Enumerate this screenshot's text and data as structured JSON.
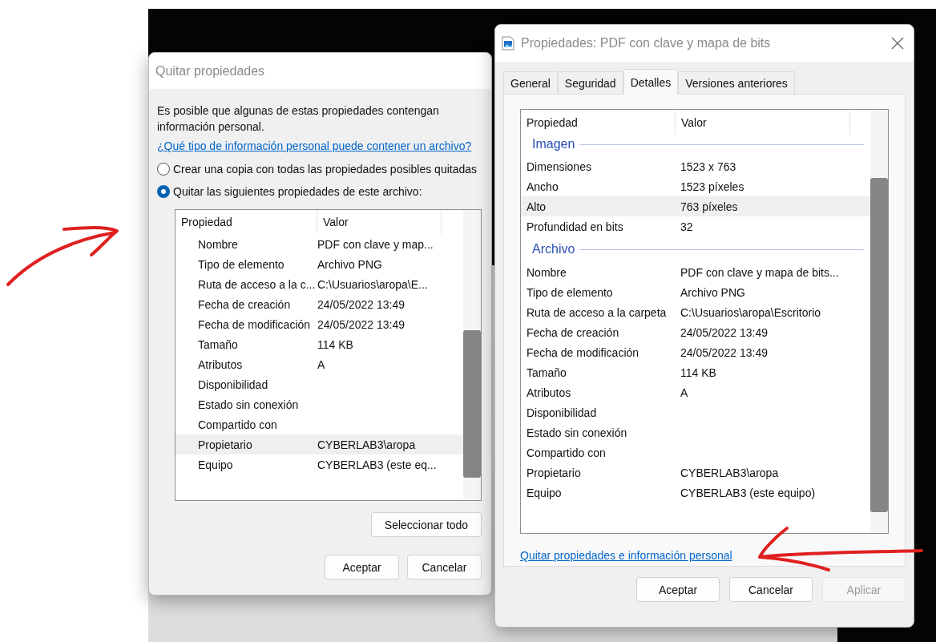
{
  "remove_dialog": {
    "title": "Quitar propiedades",
    "intro": "Es posible que algunas de estas propiedades contengan información personal.",
    "help_link": "¿Qué tipo de información personal puede contener un archivo?",
    "options": [
      {
        "label": "Crear una copia con todas las propiedades posibles quitadas",
        "selected": false
      },
      {
        "label": "Quitar las siguientes propiedades de este archivo:",
        "selected": true
      }
    ],
    "table": {
      "columns": [
        "Propiedad",
        "Valor"
      ],
      "rows": [
        {
          "property": "Nombre",
          "value": "PDF con clave y map...",
          "selected": false
        },
        {
          "property": "Tipo de elemento",
          "value": "Archivo PNG",
          "selected": false
        },
        {
          "property": "Ruta de acceso a la c...",
          "value": "C:\\Usuarios\\aropa\\E...",
          "selected": false
        },
        {
          "property": "Fecha de creación",
          "value": "24/05/2022 13:49",
          "selected": false
        },
        {
          "property": "Fecha de modificación",
          "value": "24/05/2022 13:49",
          "selected": false
        },
        {
          "property": "Tamaño",
          "value": "114 KB",
          "selected": false
        },
        {
          "property": "Atributos",
          "value": "A",
          "selected": false
        },
        {
          "property": "Disponibilidad",
          "value": "",
          "selected": false
        },
        {
          "property": "Estado sin conexión",
          "value": "",
          "selected": false
        },
        {
          "property": "Compartido con",
          "value": "",
          "selected": false
        },
        {
          "property": "Propietario",
          "value": "CYBERLAB3\\aropa",
          "selected": true
        },
        {
          "property": "Equipo",
          "value": "CYBERLAB3 (este eq...",
          "selected": false
        }
      ]
    },
    "select_all_button": "Seleccionar todo",
    "buttons": [
      {
        "label": "Aceptar",
        "disabled": false
      },
      {
        "label": "Cancelar",
        "disabled": false
      }
    ]
  },
  "properties_dialog": {
    "title": "Propiedades: PDF con clave y mapa de bits",
    "tabs": [
      {
        "label": "General",
        "selected": false
      },
      {
        "label": "Seguridad",
        "selected": false
      },
      {
        "label": "Detalles",
        "selected": true
      },
      {
        "label": "Versiones anteriores",
        "selected": false
      }
    ],
    "table": {
      "columns": [
        "Propiedad",
        "Valor"
      ],
      "groups": [
        {
          "name": "Imagen",
          "rows": [
            {
              "property": "Dimensiones",
              "value": "1523 x 763",
              "selected": false
            },
            {
              "property": "Ancho",
              "value": "1523 píxeles",
              "selected": false
            },
            {
              "property": "Alto",
              "value": "763 píxeles",
              "selected": true
            },
            {
              "property": "Profundidad en bits",
              "value": "32",
              "selected": false
            }
          ]
        },
        {
          "name": "Archivo",
          "rows": [
            {
              "property": "Nombre",
              "value": "PDF con clave y mapa de bits...",
              "selected": false
            },
            {
              "property": "Tipo de elemento",
              "value": "Archivo PNG",
              "selected": false
            },
            {
              "property": "Ruta de acceso a la carpeta",
              "value": "C:\\Usuarios\\aropa\\Escritorio",
              "selected": false
            },
            {
              "property": "Fecha de creación",
              "value": "24/05/2022 13:49",
              "selected": false
            },
            {
              "property": "Fecha de modificación",
              "value": "24/05/2022 13:49",
              "selected": false
            },
            {
              "property": "Tamaño",
              "value": "114 KB",
              "selected": false
            },
            {
              "property": "Atributos",
              "value": "A",
              "selected": false
            },
            {
              "property": "Disponibilidad",
              "value": "",
              "selected": false
            },
            {
              "property": "Estado sin conexión",
              "value": "",
              "selected": false
            },
            {
              "property": "Compartido con",
              "value": "",
              "selected": false
            },
            {
              "property": "Propietario",
              "value": "CYBERLAB3\\aropa",
              "selected": false
            },
            {
              "property": "Equipo",
              "value": "CYBERLAB3 (este equipo)",
              "selected": false
            }
          ]
        }
      ]
    },
    "link": "Quitar propiedades e información personal",
    "buttons": [
      {
        "label": "Aceptar",
        "disabled": false
      },
      {
        "label": "Cancelar",
        "disabled": false
      },
      {
        "label": "Aplicar",
        "disabled": true
      }
    ]
  }
}
